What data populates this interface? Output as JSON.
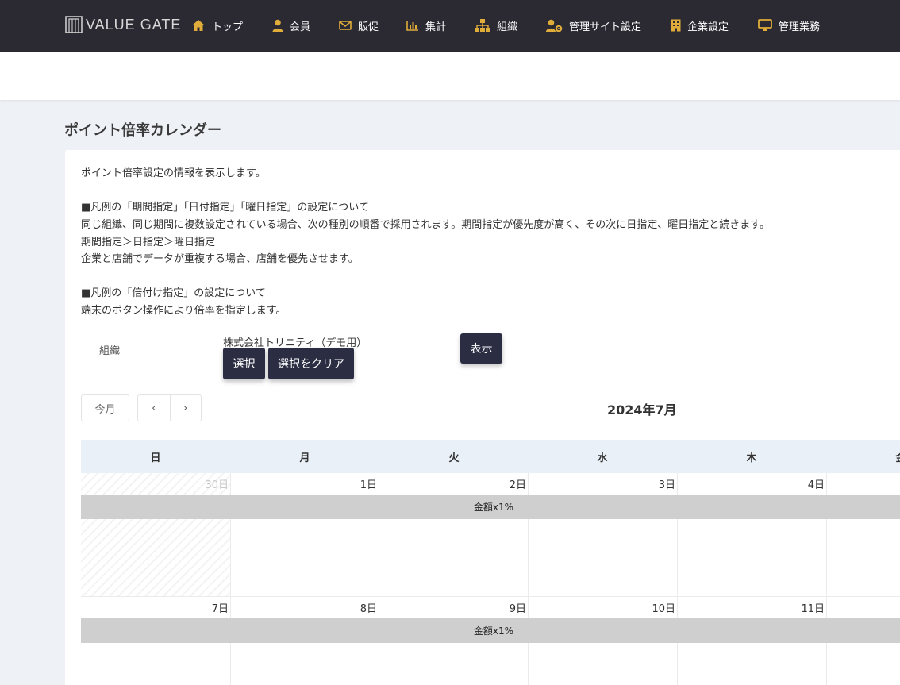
{
  "brand": {
    "logo_text": "VALUE GATE"
  },
  "nav": {
    "items": [
      {
        "label": "トップ",
        "icon": "home-icon"
      },
      {
        "label": "会員",
        "icon": "user-icon"
      },
      {
        "label": "販促",
        "icon": "envelope-icon"
      },
      {
        "label": "集計",
        "icon": "bar-chart-icon"
      },
      {
        "label": "組織",
        "icon": "sitemap-icon"
      },
      {
        "label": "管理サイト設定",
        "icon": "user-gear-icon"
      },
      {
        "label": "企業設定",
        "icon": "building-icon"
      },
      {
        "label": "管理業務",
        "icon": "monitor-icon"
      }
    ]
  },
  "colors": {
    "nav_bg": "#2b2a33",
    "icon_gold": "#e0ad3a",
    "button_bg": "#2b2e43",
    "event_bg": "#cfcfcf",
    "header_bg": "#eaf0f7"
  },
  "page": {
    "title": "ポイント倍率カレンダー"
  },
  "description": {
    "intro": "ポイント倍率設定の情報を表示します。",
    "section1_heading": "■凡例の「期間指定」「日付指定」「曜日指定」の設定について",
    "section1_line1": "同じ組織、同じ期間に複数設定されている場合、次の種別の順番で採用されます。期間指定が優先度が高く、その次に日指定、曜日指定と続きます。",
    "section1_line2": "期間指定＞日指定＞曜日指定",
    "section1_line3": "企業と店舗でデータが重複する場合、店舗を優先させます。",
    "section2_heading": "■凡例の「倍付け指定」の設定について",
    "section2_line1": "端末のボタン操作により倍率を指定します。"
  },
  "filter": {
    "org_label": "組織",
    "org_value": "株式会社トリニティ（デモ用）",
    "select_label": "選択",
    "clear_label": "選択をクリア",
    "show_label": "表示"
  },
  "calendar": {
    "today_label": "今月",
    "prev_label": "‹",
    "next_label": "›",
    "month_title": "2024年7月",
    "weekdays": [
      "日",
      "月",
      "火",
      "水",
      "木",
      "金"
    ],
    "weeks": [
      {
        "days": [
          "30日",
          "1日",
          "2日",
          "3日",
          "4日"
        ],
        "event": "金額x1%"
      },
      {
        "days": [
          "7日",
          "8日",
          "9日",
          "10日",
          "11日"
        ],
        "event": "金額x1%"
      }
    ]
  }
}
